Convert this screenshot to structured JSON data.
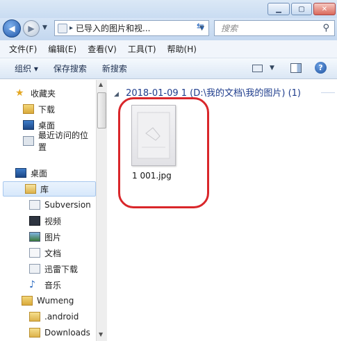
{
  "window": {
    "minimize_icon": "minimize-icon",
    "maximize_icon": "maximize-icon",
    "close_icon": "close-icon"
  },
  "navigation": {
    "address_path": "已导入的图片和视...",
    "search_placeholder": "搜索"
  },
  "menu": [
    "文件(F)",
    "编辑(E)",
    "查看(V)",
    "工具(T)",
    "帮助(H)"
  ],
  "toolbar": {
    "organize": "组织 ▾",
    "save_search": "保存搜索",
    "new_search": "新搜索"
  },
  "sidebar": {
    "favorites": {
      "label": "收藏夹",
      "items": [
        "下载",
        "桌面",
        "最近访问的位置"
      ]
    },
    "desktop": "桌面",
    "library": "库",
    "library_items": [
      "Subversion",
      "视频",
      "图片",
      "文档",
      "迅雷下载",
      "音乐"
    ],
    "user": "Wumeng",
    "user_items": [
      ".android",
      "Downloads"
    ]
  },
  "content": {
    "group_title": "2018-01-09 1 (D:\\我的文档\\我的图片) (1)",
    "file_name": "1 001.jpg"
  },
  "colors": {
    "highlight_ring": "#d9262a",
    "group_text": "#1e3c8c"
  }
}
